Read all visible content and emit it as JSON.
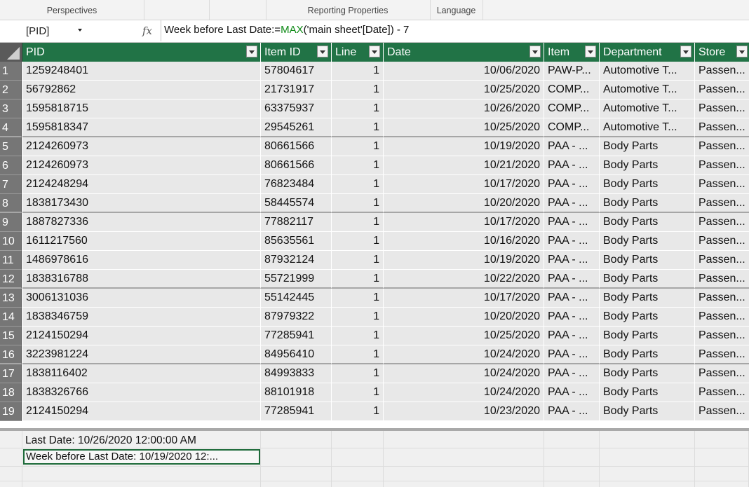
{
  "ribbon": {
    "perspectives": "Perspectives",
    "reporting_properties": "Reporting Properties",
    "language": "Language"
  },
  "formula_bar": {
    "name_box": "[PID]",
    "fx": "fx",
    "formula_prefix": "Week before Last Date:=",
    "formula_fn": "MAX",
    "formula_suffix": "('main sheet'[Date]) - 7"
  },
  "table": {
    "columns": [
      "PID",
      "Item ID",
      "Line",
      "Date",
      "Item",
      "Department",
      "Store"
    ],
    "rows": [
      [
        "1",
        "1259248401",
        "57804617",
        "1",
        "10/06/2020",
        "PAW-P...",
        "Automotive T...",
        "Passen..."
      ],
      [
        "2",
        "56792862",
        "21731917",
        "1",
        "10/25/2020",
        "COMP...",
        "Automotive T...",
        "Passen..."
      ],
      [
        "3",
        "1595818715",
        "63375937",
        "1",
        "10/26/2020",
        "COMP...",
        "Automotive T...",
        "Passen..."
      ],
      [
        "4",
        "1595818347",
        "29545261",
        "1",
        "10/25/2020",
        "COMP...",
        "Automotive T...",
        "Passen..."
      ],
      [
        "5",
        "2124260973",
        "80661566",
        "1",
        "10/19/2020",
        "PAA - ...",
        "Body Parts",
        "Passen..."
      ],
      [
        "6",
        "2124260973",
        "80661566",
        "1",
        "10/21/2020",
        "PAA - ...",
        "Body Parts",
        "Passen..."
      ],
      [
        "7",
        "2124248294",
        "76823484",
        "1",
        "10/17/2020",
        "PAA - ...",
        "Body Parts",
        "Passen..."
      ],
      [
        "8",
        "1838173430",
        "58445574",
        "1",
        "10/20/2020",
        "PAA - ...",
        "Body Parts",
        "Passen..."
      ],
      [
        "9",
        "1887827336",
        "77882117",
        "1",
        "10/17/2020",
        "PAA - ...",
        "Body Parts",
        "Passen..."
      ],
      [
        "10",
        "1611217560",
        "85635561",
        "1",
        "10/16/2020",
        "PAA - ...",
        "Body Parts",
        "Passen..."
      ],
      [
        "11",
        "1486978616",
        "87932124",
        "1",
        "10/19/2020",
        "PAA - ...",
        "Body Parts",
        "Passen..."
      ],
      [
        "12",
        "1838316788",
        "55721999",
        "1",
        "10/22/2020",
        "PAA - ...",
        "Body Parts",
        "Passen..."
      ],
      [
        "13",
        "3006131036",
        "55142445",
        "1",
        "10/17/2020",
        "PAA - ...",
        "Body Parts",
        "Passen..."
      ],
      [
        "14",
        "1838346759",
        "87979322",
        "1",
        "10/20/2020",
        "PAA - ...",
        "Body Parts",
        "Passen..."
      ],
      [
        "15",
        "2124150294",
        "77285941",
        "1",
        "10/25/2020",
        "PAA - ...",
        "Body Parts",
        "Passen..."
      ],
      [
        "16",
        "3223981224",
        "84956410",
        "1",
        "10/24/2020",
        "PAA - ...",
        "Body Parts",
        "Passen..."
      ],
      [
        "17",
        "1838116402",
        "84993833",
        "1",
        "10/24/2020",
        "PAA - ...",
        "Body Parts",
        "Passen..."
      ],
      [
        "18",
        "1838326766",
        "88101918",
        "1",
        "10/24/2020",
        "PAA - ...",
        "Body Parts",
        "Passen..."
      ],
      [
        "19",
        "2124150294",
        "77285941",
        "1",
        "10/23/2020",
        "PAA - ...",
        "Body Parts",
        "Passen..."
      ]
    ]
  },
  "calc_area": {
    "measure_1": "Last Date: 10/26/2020 12:00:00 AM",
    "measure_2": "Week before Last Date: 10/19/2020 12:..."
  },
  "colors": {
    "header_green": "#217346",
    "formula_function": "#0e8a16"
  }
}
